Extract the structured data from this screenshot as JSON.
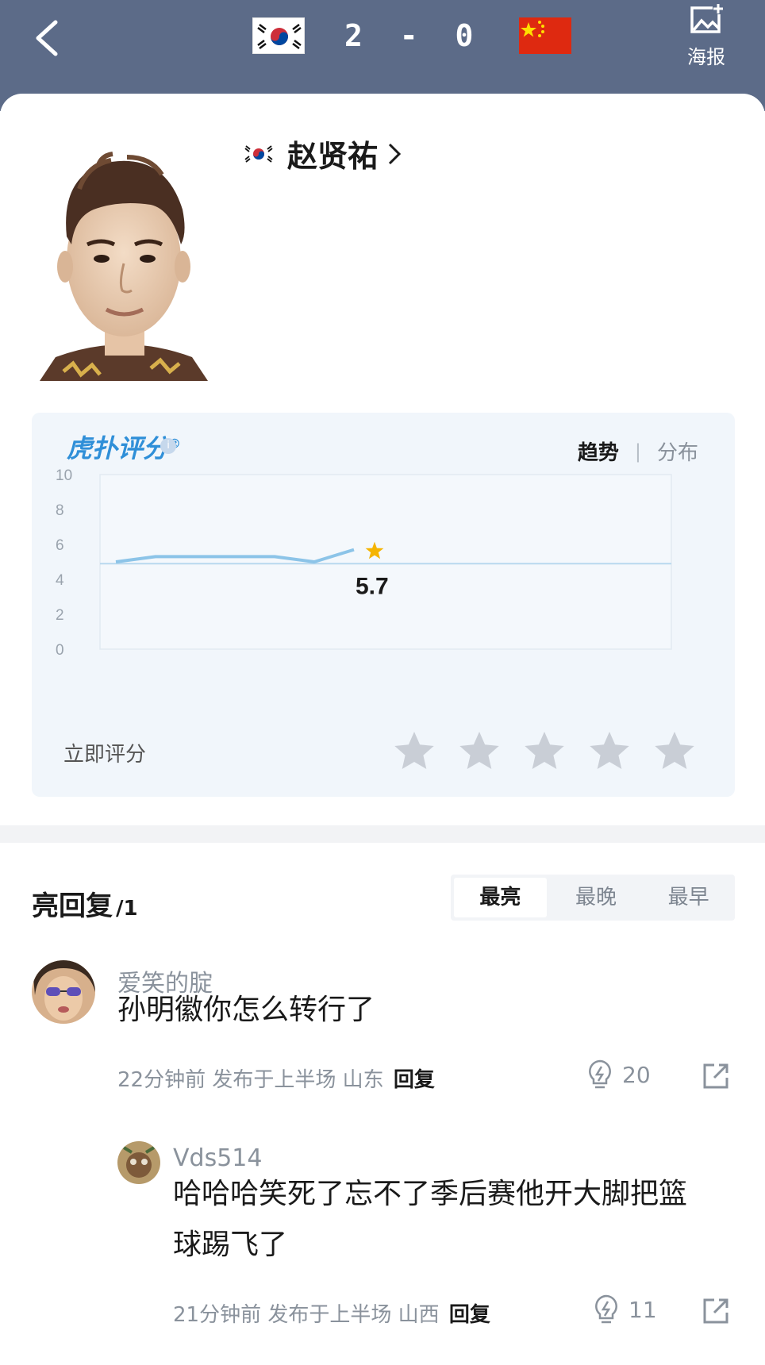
{
  "header": {
    "score": "2 - 0",
    "home_flag": "south-korea-flag-icon",
    "away_flag": "china-flag-icon",
    "poster_label": "海报",
    "background": "#5c6b88"
  },
  "player": {
    "name": "赵贤祐",
    "flag": "south-korea-flag-icon"
  },
  "rating": {
    "logo": "虎扑评分",
    "logo_mark": "®",
    "tabs": [
      "趋势",
      "分布"
    ],
    "active_tab": "趋势",
    "rate_now_label": "立即评分",
    "current_value": "5.7",
    "star_count": 5
  },
  "chart_data": {
    "type": "line",
    "yticks": [
      "10",
      "8",
      "6",
      "4",
      "2",
      "0"
    ],
    "ylim": [
      0,
      10
    ],
    "series": [
      {
        "values": [
          5.0,
          5.3,
          5.3,
          5.3,
          5.3,
          5.0,
          5.7
        ]
      }
    ],
    "reference_line": 4.9,
    "latest_label": "5.7",
    "latest_marker": "star-icon",
    "line_color": "#8cc4e8",
    "marker_color": "#f5b400"
  },
  "replies": {
    "title": "亮回复",
    "count": "/1",
    "sort_tabs": [
      "最亮",
      "最晚",
      "最早"
    ],
    "active_sort": "最亮",
    "items": [
      {
        "user": "爱笑的腚",
        "text": "孙明徽你怎么转行了",
        "meta": "22分钟前 发布于上半场 山东",
        "reply_label": "回复",
        "lights": "20"
      },
      {
        "user": "Vds514",
        "text_line1": "哈哈哈笑死了忘不了季后赛他开大脚把篮",
        "text_line2": "球踢飞了",
        "meta": "21分钟前 发布于上半场 山西",
        "reply_label": "回复",
        "lights": "11"
      }
    ]
  }
}
